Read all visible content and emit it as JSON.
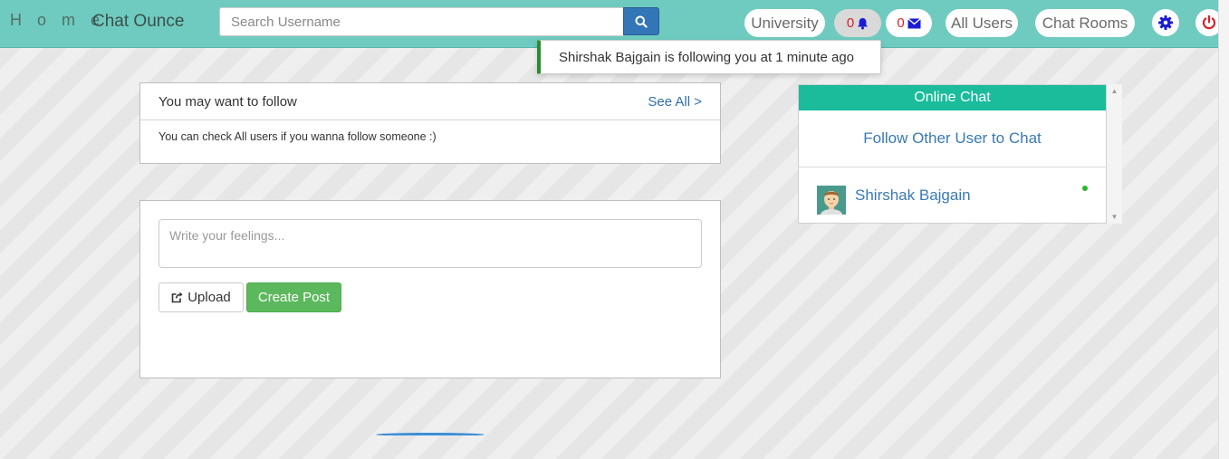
{
  "navbar": {
    "home_label": "H o m e",
    "brand": "Chat Ounce",
    "search_placeholder": "Search Username",
    "university_label": "University",
    "notification_count": "0",
    "message_count": "0",
    "all_users_label": "All Users",
    "chat_rooms_label": "Chat Rooms",
    "bg_color": "#6fcbbf"
  },
  "toast": {
    "message": "Shirshak Bajgain is following you at 1 minute ago"
  },
  "follow_panel": {
    "title": "You may want to follow",
    "see_all": "See All >",
    "body": "You can check All users if you wanna follow someone :)"
  },
  "post_panel": {
    "placeholder": "Write your feelings...",
    "upload_label": "Upload",
    "create_label": "Create Post"
  },
  "chat_panel": {
    "title": "Online Chat",
    "follow_prompt": "Follow Other User to Chat",
    "users": [
      {
        "name": "Shirshak Bajgain",
        "status": "online"
      }
    ],
    "accent_color": "#1abc9c"
  },
  "icons": {
    "search": "search-icon",
    "bell": "bell-icon",
    "envelope": "envelope-icon",
    "gear": "gear-icon",
    "power": "power-icon",
    "upload": "share-square-icon"
  }
}
